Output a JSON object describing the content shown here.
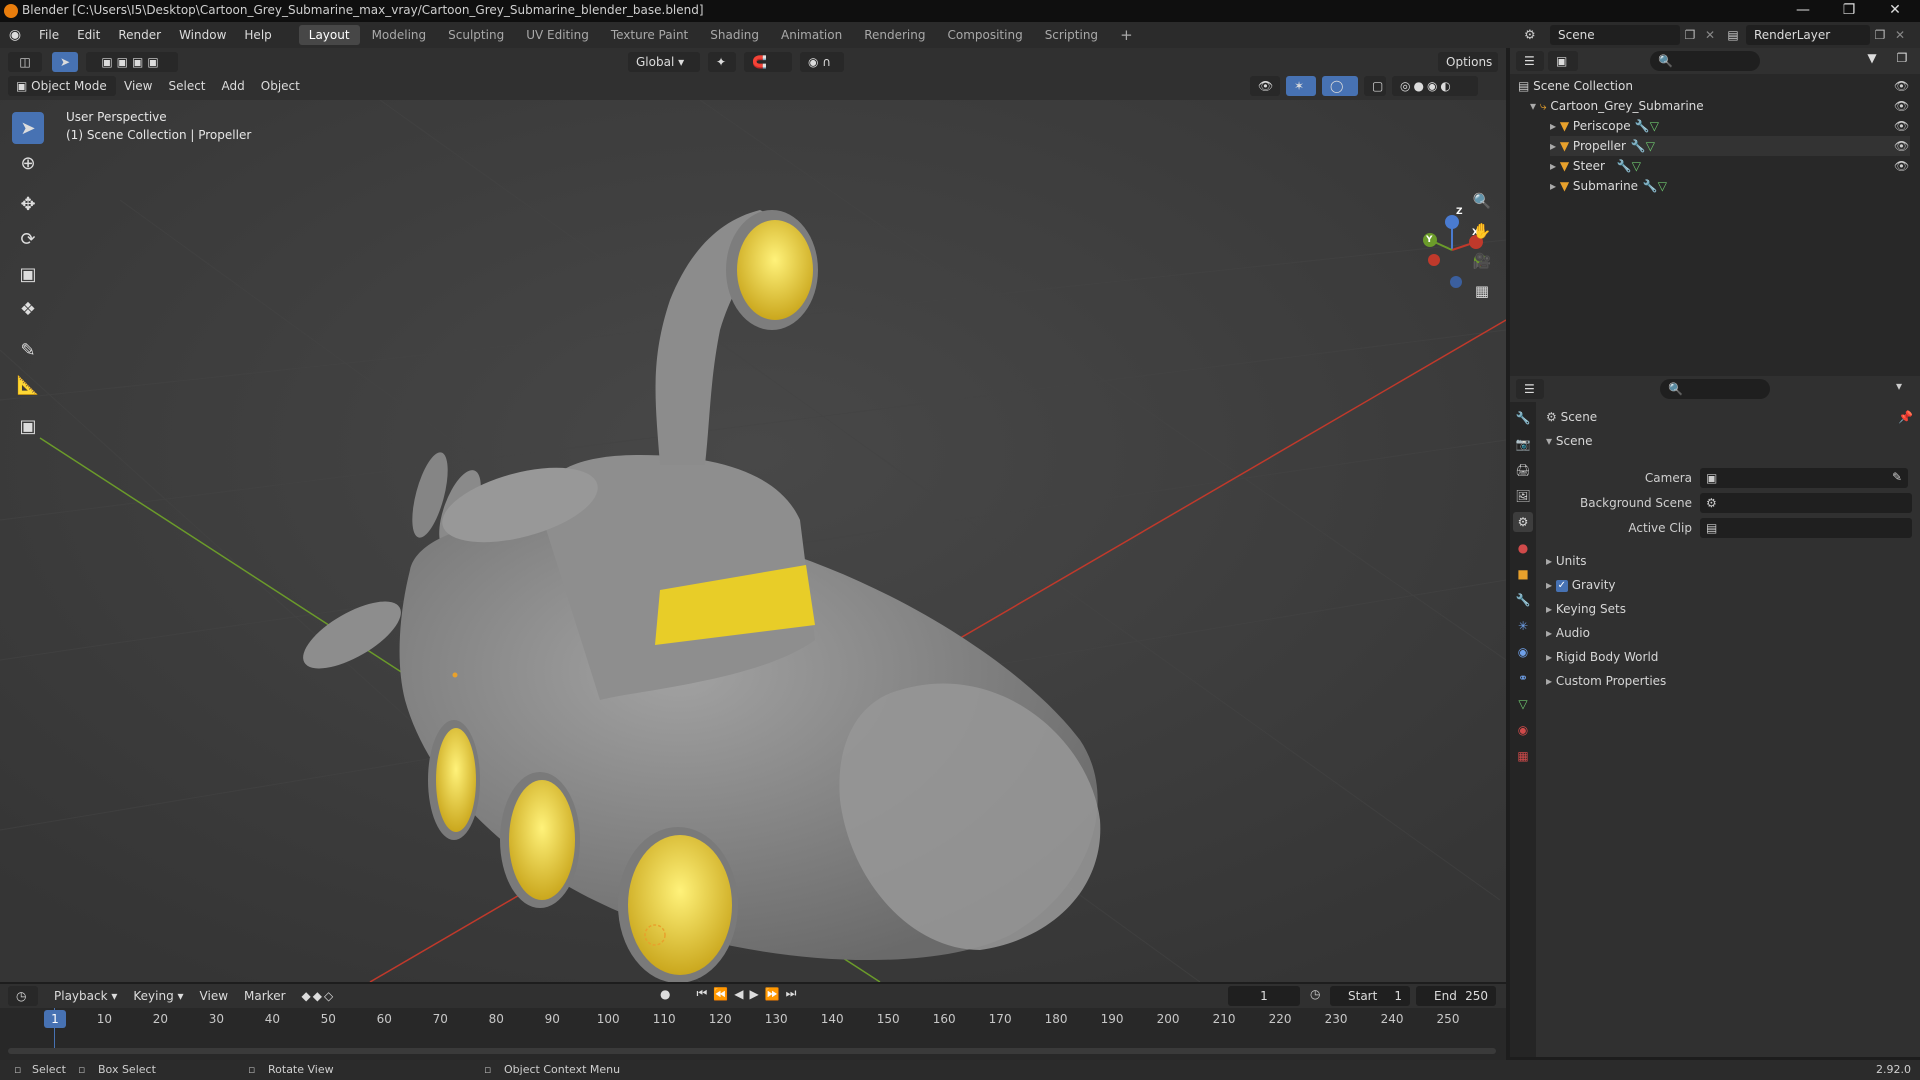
{
  "window": {
    "title": "Blender [C:\\Users\\I5\\Desktop\\Cartoon_Grey_Submarine_max_vray/Cartoon_Grey_Submarine_blender_base.blend]"
  },
  "menu": [
    "File",
    "Edit",
    "Render",
    "Window",
    "Help"
  ],
  "workspaces": [
    "Layout",
    "Modeling",
    "Sculpting",
    "UV Editing",
    "Texture Paint",
    "Shading",
    "Animation",
    "Rendering",
    "Compositing",
    "Scripting"
  ],
  "scene_field": "Scene",
  "renderlayer_field": "RenderLayer",
  "viewport": {
    "transform_orientation": "Global",
    "options_label": "Options",
    "mode": "Object Mode",
    "menus": [
      "View",
      "Select",
      "Add",
      "Object"
    ],
    "perspective": "User Perspective",
    "collection_info": "(1) Scene Collection | Propeller",
    "gizmo_axes": [
      "X",
      "Y",
      "Z"
    ]
  },
  "outliner": {
    "root": "Scene Collection",
    "collection": "Cartoon_Grey_Submarine",
    "objects": [
      "Periscope",
      "Propeller",
      "Steer",
      "Submarine"
    ]
  },
  "properties": {
    "breadcrumb": "Scene",
    "panel_title": "Scene",
    "fields": [
      {
        "label": "Camera"
      },
      {
        "label": "Background Scene"
      },
      {
        "label": "Active Clip"
      }
    ],
    "subpanels": [
      "Units",
      "Gravity",
      "Keying Sets",
      "Audio",
      "Rigid Body World",
      "Custom Properties"
    ],
    "gravity_checked": true
  },
  "timeline": {
    "menus": [
      "Playback",
      "Keying",
      "View",
      "Marker"
    ],
    "current_frame": "1",
    "start_label": "Start",
    "start_value": "1",
    "end_label": "End",
    "end_value": "250",
    "ticks": [
      "1",
      "10",
      "20",
      "30",
      "40",
      "50",
      "60",
      "70",
      "80",
      "90",
      "100",
      "110",
      "120",
      "130",
      "140",
      "150",
      "160",
      "170",
      "180",
      "190",
      "200",
      "210",
      "220",
      "230",
      "240",
      "250"
    ]
  },
  "statusbar": {
    "select": "Select",
    "box_select": "Box Select",
    "rotate_view": "Rotate View",
    "context_menu": "Object Context Menu",
    "version": "2.92.0"
  },
  "colors": {
    "accent": "#4772b3",
    "submarine_grey": "#8a8a8a",
    "window_yellow": "#e8d02c",
    "axis_red": "#c0392b",
    "axis_green": "#6b9b2a"
  }
}
